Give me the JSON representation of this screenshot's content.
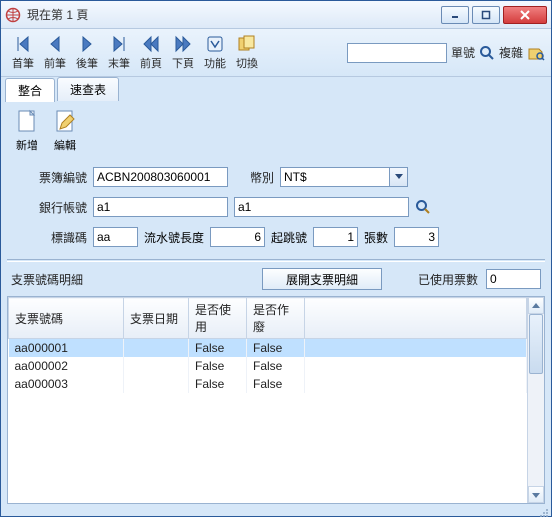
{
  "window": {
    "title": "現在第 1 頁"
  },
  "toolbar": {
    "first": "首筆",
    "prev": "前筆",
    "next": "後筆",
    "last": "末筆",
    "prevpage": "前頁",
    "nextpage": "下頁",
    "func": "功能",
    "switch": "切換",
    "form_no_label": "單號",
    "complex_label": "複雜",
    "search_value": ""
  },
  "tabs": {
    "t1": "整合",
    "t2": "速查表"
  },
  "ops": {
    "add": "新增",
    "edit": "編輯"
  },
  "form": {
    "book_no_label": "票簿編號",
    "book_no": "ACBN200803060001",
    "currency_label": "幣別",
    "currency": "NT$",
    "bank_label": "銀行帳號",
    "bank1": "a1",
    "bank2": "a1",
    "idcode_label": "標識碼",
    "idcode": "aa",
    "serial_len_label": "流水號長度",
    "serial_len": "6",
    "start_label": "起跳號",
    "start": "1",
    "pages_label": "張數",
    "pages": "3"
  },
  "detail": {
    "header": "支票號碼明細",
    "expand": "展開支票明細",
    "used_label": "已使用票數",
    "used_value": "0"
  },
  "grid": {
    "cols": {
      "no": "支票號碼",
      "date": "支票日期",
      "used": "是否使用",
      "void": "是否作廢"
    },
    "rows": [
      {
        "no": "aa000001",
        "date": "",
        "used": "False",
        "void": "False"
      },
      {
        "no": "aa000002",
        "date": "",
        "used": "False",
        "void": "False"
      },
      {
        "no": "aa000003",
        "date": "",
        "used": "False",
        "void": "False"
      }
    ]
  }
}
